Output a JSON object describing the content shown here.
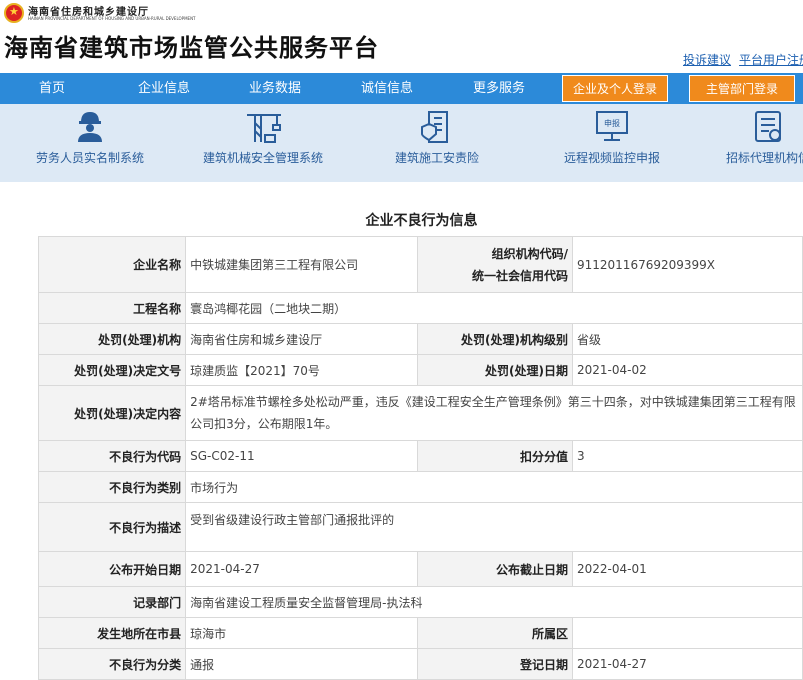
{
  "header": {
    "dept_cn": "海南省住房和城乡建设厅",
    "dept_en": "HAINAN PROVINCIAL DEPARTMENT OF HOUSING AND URBAN-RURAL DEVELOPMENT",
    "site_title": "海南省建筑市场监管公共服务平台",
    "links": [
      "投诉建议",
      "平台用户注册"
    ]
  },
  "nav": {
    "items": [
      "首页",
      "企业信息",
      "业务数据",
      "诚信信息",
      "更多服务"
    ],
    "login_buttons": [
      "企业及个人登录",
      "主管部门登录"
    ]
  },
  "quick_links": [
    {
      "label": "劳务人员实名制系统",
      "icon": "worker-icon"
    },
    {
      "label": "建筑机械安全管理系统",
      "icon": "tower-crane-icon"
    },
    {
      "label": "建筑施工安责险",
      "icon": "insurance-building-icon"
    },
    {
      "label": "远程视频监控申报",
      "icon": "monitor-report-icon"
    },
    {
      "label": "招标代理机构信",
      "icon": "document-icon"
    }
  ],
  "page_title": "企业不良行为信息",
  "record": {
    "company_name_label": "企业名称",
    "company_name": "中铁城建集团第三工程有限公司",
    "org_code_label_1": "组织机构代码/",
    "org_code_label_2": "统一社会信用代码",
    "org_code": "91120116769209399X",
    "project_label": "工程名称",
    "project": "寰岛鸿椰花园（二地块二期）",
    "penalty_org_label": "处罚(处理)机构",
    "penalty_org": "海南省住房和城乡建设厅",
    "penalty_level_label": "处罚(处理)机构级别",
    "penalty_level": "省级",
    "doc_no_label": "处罚(处理)决定文号",
    "doc_no": "琼建质监【2021】70号",
    "penalty_date_label": "处罚(处理)日期",
    "penalty_date": "2021-04-02",
    "content_label": "处罚(处理)决定内容",
    "content_line1": "2#塔吊标准节螺栓多处松动严重，违反《建设工程安全生产管理条例》第三十四条，对中铁城建集团第三工程有限",
    "content_line2": "公司扣3分，公布期限1年。",
    "code_label": "不良行为代码",
    "code": "SG-C02-11",
    "points_label": "扣分分值",
    "points": "3",
    "category_label": "不良行为类别",
    "category": "市场行为",
    "desc_label": "不良行为描述",
    "desc": "受到省级建设行政主管部门通报批评的",
    "publish_start_label": "公布开始日期",
    "publish_start": "2021-04-27",
    "publish_end_label": "公布截止日期",
    "publish_end": "2022-04-01",
    "record_dept_label": "记录部门",
    "record_dept": "海南省建设工程质量安全监督管理局-执法科",
    "city_label": "发生地所在市县",
    "city": "琼海市",
    "district_label": "所属区",
    "district": "",
    "class_label": "不良行为分类",
    "class": "通报",
    "reg_date_label": "登记日期",
    "reg_date": "2021-04-27"
  },
  "colors": {
    "nav_bg": "#2c8ad9",
    "login_btn": "#f08a1c",
    "quick_bg": "#dde9f5",
    "link": "#1c5fb0"
  }
}
